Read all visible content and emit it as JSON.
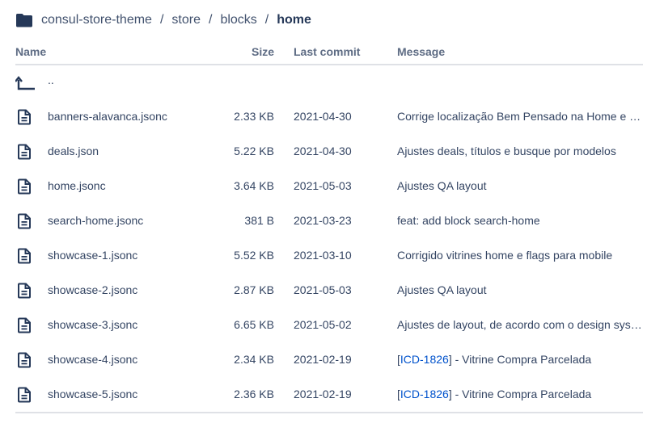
{
  "breadcrumb": {
    "icon": "folder-icon",
    "items": [
      "consul-store-theme",
      "store",
      "blocks"
    ],
    "current": "home",
    "separator": "/"
  },
  "table": {
    "headers": {
      "name": "Name",
      "size": "Size",
      "last_commit": "Last commit",
      "message": "Message"
    },
    "parent_label": "..",
    "rows": [
      {
        "name": "banners-alavanca.jsonc",
        "size": "2.33 KB",
        "date": "2021-04-30",
        "message": "Corrige localização Bem Pensado na Home e in..."
      },
      {
        "name": "deals.json",
        "size": "5.22 KB",
        "date": "2021-04-30",
        "message": "Ajustes deals, títulos e busque por modelos"
      },
      {
        "name": "home.jsonc",
        "size": "3.64 KB",
        "date": "2021-05-03",
        "message": "Ajustes QA layout"
      },
      {
        "name": "search-home.jsonc",
        "size": "381 B",
        "date": "2021-03-23",
        "message": "feat: add block search-home"
      },
      {
        "name": "showcase-1.jsonc",
        "size": "5.52 KB",
        "date": "2021-03-10",
        "message": "Corrigido vitrines home e flags para mobile"
      },
      {
        "name": "showcase-2.jsonc",
        "size": "2.87 KB",
        "date": "2021-05-03",
        "message": "Ajustes QA layout"
      },
      {
        "name": "showcase-3.jsonc",
        "size": "6.65 KB",
        "date": "2021-05-02",
        "message": "Ajustes de layout, de acordo com o design syst..."
      },
      {
        "name": "showcase-4.jsonc",
        "size": "2.34 KB",
        "date": "2021-02-19",
        "issue": "ICD-1826",
        "message_pre": "[",
        "message_post": "] - Vitrine Compra Parcelada"
      },
      {
        "name": "showcase-5.jsonc",
        "size": "2.36 KB",
        "date": "2021-02-19",
        "issue": "ICD-1826",
        "message_pre": "[",
        "message_post": "] - Vitrine Compra Parcelada"
      }
    ]
  },
  "colors": {
    "text": "#344563",
    "header": "#5e6c84",
    "link": "#0052cc",
    "folder": "#253858",
    "border": "#dfe1e6"
  }
}
